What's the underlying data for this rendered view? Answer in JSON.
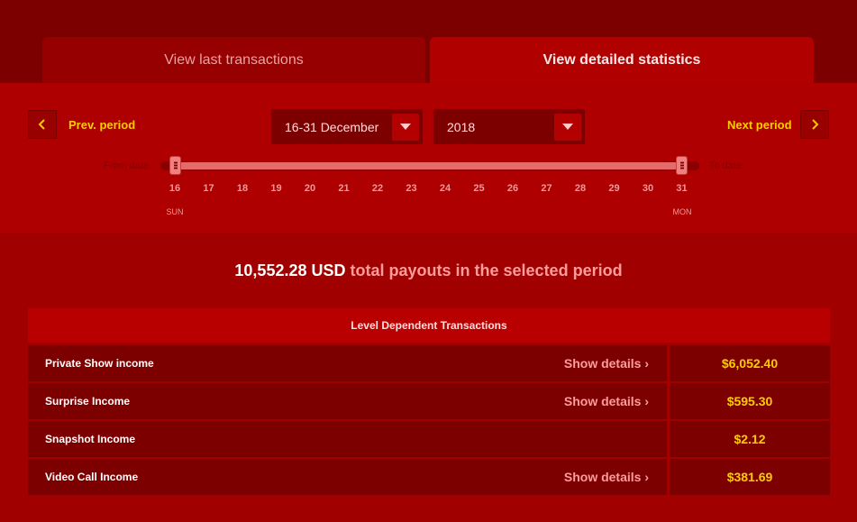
{
  "tabs": {
    "last_transactions": "View last transactions",
    "detailed_statistics": "View detailed statistics"
  },
  "nav": {
    "prev_label": "Prev. period",
    "next_label": "Next period"
  },
  "selects": {
    "period": "16-31 December",
    "year": "2018"
  },
  "slider": {
    "from_label": "From date",
    "to_label": "To date",
    "start_day": "16",
    "end_day": "31",
    "days": [
      "16",
      "17",
      "18",
      "19",
      "20",
      "21",
      "22",
      "23",
      "24",
      "25",
      "26",
      "27",
      "28",
      "29",
      "30",
      "31"
    ],
    "start_dow": "SUN",
    "end_dow": "MON"
  },
  "summary": {
    "amount": "10,552.28 USD",
    "text": "total payouts in the selected period"
  },
  "table": {
    "header": "Level Dependent Transactions",
    "rows": [
      {
        "name": "Private Show income",
        "link": "Show details ›",
        "value": "$6,052.40"
      },
      {
        "name": "Surprise Income",
        "link": "Show details ›",
        "value": "$595.30"
      },
      {
        "name": "Snapshot Income",
        "link": "",
        "value": "$2.12"
      },
      {
        "name": "Video Call Income",
        "link": "Show details ›",
        "value": "$381.69"
      }
    ]
  },
  "colors": {
    "background": "#a00000",
    "accent": "#ffcc00",
    "row_bg": "#7d0000"
  }
}
